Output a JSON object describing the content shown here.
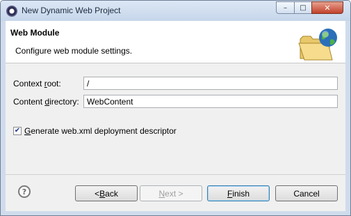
{
  "window": {
    "title": "New Dynamic Web Project",
    "controls": {
      "minimize": "–",
      "maximize": "□",
      "close": "✕"
    }
  },
  "header": {
    "title": "Web Module",
    "description": "Configure web module settings.",
    "icon": "globe-folder-icon"
  },
  "form": {
    "context_root": {
      "label_pre": "Context ",
      "label_mnemonic": "r",
      "label_post": "oot:",
      "value": "/"
    },
    "content_directory": {
      "label_pre": "Content ",
      "label_mnemonic": "d",
      "label_post": "irectory:",
      "value": "WebContent"
    },
    "generate_descriptor": {
      "checked": true,
      "label_mnemonic": "G",
      "label_post": "enerate web.xml deployment descriptor",
      "mark": "✔"
    }
  },
  "footer": {
    "help": "?",
    "back": {
      "pre": "< ",
      "mnemonic": "B",
      "post": "ack"
    },
    "next": {
      "mnemonic": "N",
      "post": "ext >"
    },
    "finish": {
      "mnemonic": "F",
      "post": "inish"
    },
    "cancel": {
      "label": "Cancel"
    }
  },
  "colors": {
    "accent": "#3c7fb1",
    "title_bar": "#cfdcec",
    "close": "#c2412a"
  }
}
